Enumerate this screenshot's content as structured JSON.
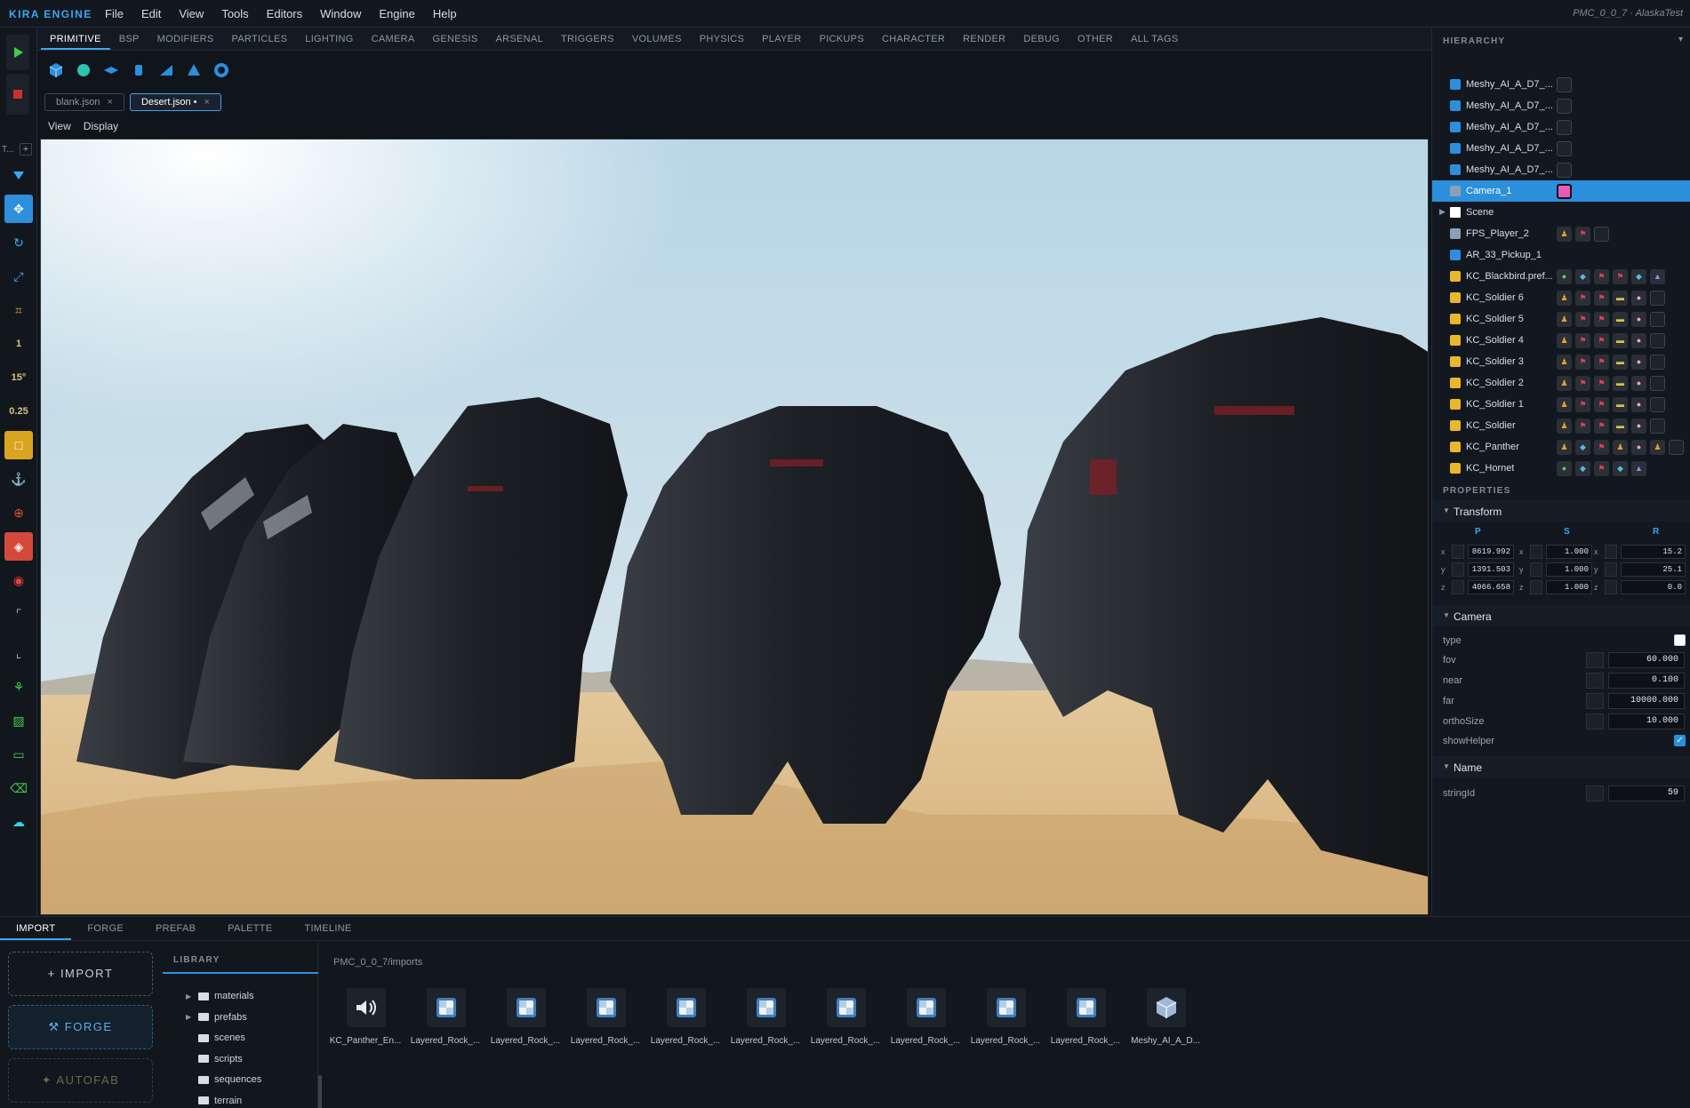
{
  "app": {
    "logo": "KIRA ENGINE",
    "project": "PMC_0_0_7 · AlaskaTest"
  },
  "menu": [
    "File",
    "Edit",
    "View",
    "Tools",
    "Editors",
    "Window",
    "Engine",
    "Help"
  ],
  "category_tabs": [
    "PRIMITIVE",
    "BSP",
    "MODIFIERS",
    "PARTICLES",
    "LIGHTING",
    "CAMERA",
    "GENESIS",
    "ARSENAL",
    "TRIGGERS",
    "VOLUMES",
    "PHYSICS",
    "PLAYER",
    "PICKUPS",
    "CHARACTER",
    "RENDER",
    "DEBUG",
    "OTHER",
    "ALL TAGS"
  ],
  "file_tabs": [
    {
      "label": "blank.json",
      "close": "×"
    },
    {
      "label": "Desert.json •",
      "close": "×"
    }
  ],
  "viewport_menu": [
    "View",
    "Display"
  ],
  "toolbar": {
    "tab_label": "T...",
    "plus": "+",
    "grid_size": "1",
    "angle_snap": "15°",
    "scale_snap": "0.25"
  },
  "hierarchy": {
    "title": "HIERARCHY",
    "collapse": "▾",
    "items": [
      {
        "name": "Meshy_AI_A_D7_..."
      },
      {
        "name": "Meshy_AI_A_D7_..."
      },
      {
        "name": "Meshy_AI_A_D7_..."
      },
      {
        "name": "Meshy_AI_A_D7_..."
      },
      {
        "name": "Meshy_AI_A_D7_..."
      },
      {
        "name": "Camera_1"
      },
      {
        "name": "Scene",
        "arrow": "▶"
      },
      {
        "name": "FPS_Player_2"
      },
      {
        "name": "AR_33_Pickup_1"
      },
      {
        "name": "KC_Blackbird.pref..."
      },
      {
        "name": "KC_Soldier 6"
      },
      {
        "name": "KC_Soldier 5"
      },
      {
        "name": "KC_Soldier 4"
      },
      {
        "name": "KC_Soldier 3"
      },
      {
        "name": "KC_Soldier 2"
      },
      {
        "name": "KC_Soldier 1"
      },
      {
        "name": "KC_Soldier"
      },
      {
        "name": "KC_Panther"
      },
      {
        "name": "KC_Hornet"
      }
    ]
  },
  "properties": {
    "title": "PROPERTIES",
    "transform": {
      "title": "Transform",
      "arrow": "▼",
      "cols": [
        "P",
        "S",
        "R"
      ],
      "axes": [
        "x",
        "y",
        "z"
      ],
      "p": [
        "8619.992",
        "1391.503",
        "4066.658"
      ],
      "s": [
        "1.000",
        "1.000",
        "1.000"
      ],
      "r": [
        "15.2",
        "25.1",
        "0.0"
      ]
    },
    "camera": {
      "title": "Camera",
      "arrow": "▼",
      "labels": {
        "type": "type",
        "fov": "fov",
        "near": "near",
        "far": "far",
        "ortho": "orthoSize",
        "helper": "showHelper"
      },
      "fov": "60.000",
      "near": "0.100",
      "far": "10000.000",
      "ortho": "10.000",
      "check": "✓"
    },
    "name": {
      "title": "Name",
      "arrow": "▼",
      "label": "stringId",
      "value": "59"
    }
  },
  "bottom": {
    "tabs": [
      "IMPORT",
      "FORGE",
      "PREFAB",
      "PALETTE",
      "TIMELINE"
    ],
    "buttons": {
      "import": "+  IMPORT",
      "forge": "⚒  FORGE",
      "autofab": "✦  AUTOFAB"
    },
    "library": {
      "title": "LIBRARY",
      "items": [
        {
          "name": "materials",
          "tri": "▶"
        },
        {
          "name": "prefabs",
          "tri": "▶"
        },
        {
          "name": "scenes",
          "tri": ""
        },
        {
          "name": "scripts",
          "tri": ""
        },
        {
          "name": "sequences",
          "tri": ""
        },
        {
          "name": "terrain",
          "tri": ""
        }
      ]
    },
    "path": "PMC_0_0_7/imports",
    "assets": [
      "KC_Panther_En...",
      "Layered_Rock_...",
      "Layered_Rock_...",
      "Layered_Rock_...",
      "Layered_Rock_...",
      "Layered_Rock_...",
      "Layered_Rock_...",
      "Layered_Rock_...",
      "Layered_Rock_...",
      "Layered_Rock_...",
      "Meshy_AI_A_D..."
    ]
  }
}
